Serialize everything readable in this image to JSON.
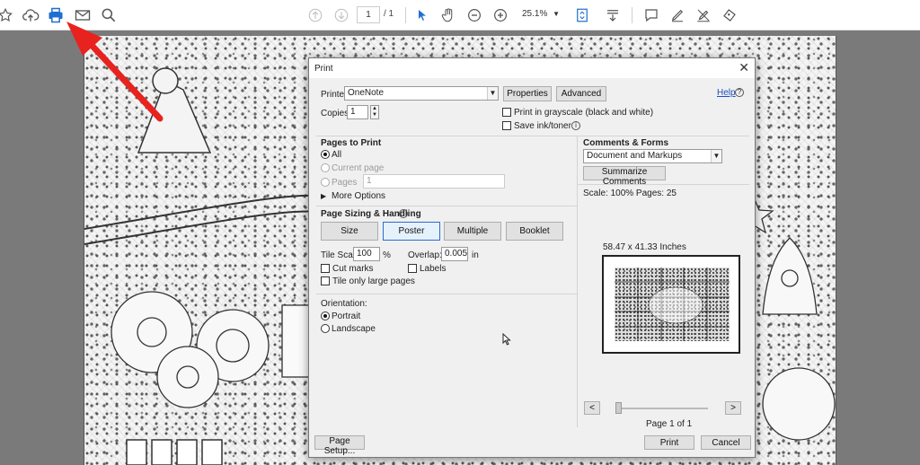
{
  "toolbar": {
    "page_current": "1",
    "page_total": "/ 1",
    "zoom": "25.1%",
    "icons": [
      "star-icon",
      "cloud-upload-icon",
      "printer-icon",
      "mail-icon",
      "zoom-search-icon",
      "page-up-icon",
      "page-down-icon",
      "select-cursor-icon",
      "hand-tool-icon",
      "zoom-out-icon",
      "zoom-in-icon",
      "fit-page-icon",
      "scroll-mode-icon",
      "comment-icon",
      "pen-icon",
      "sign-icon",
      "stamp-icon"
    ]
  },
  "dialog": {
    "title": "Print",
    "help": "Help",
    "printer_label": "Printer:",
    "printer_value": "OneNote",
    "properties_label": "Properties",
    "advanced_label": "Advanced",
    "copies_label": "Copies:",
    "copies_value": "1",
    "grayscale_label": "Print in grayscale (black and white)",
    "save_ink_label": "Save ink/toner",
    "pages_to_print": {
      "title": "Pages to Print",
      "all": "All",
      "current": "Current page",
      "pages": "Pages",
      "pages_value": "1",
      "more": "More Options"
    },
    "sizing": {
      "title": "Page Sizing & Handling",
      "size": "Size",
      "poster": "Poster",
      "multiple": "Multiple",
      "booklet": "Booklet",
      "tile_scale_label": "Tile Scale:",
      "tile_scale_value": "100",
      "percent": "%",
      "overlap_label": "Overlap:",
      "overlap_value": "0.005",
      "overlap_unit": "in",
      "cut_marks": "Cut marks",
      "labels": "Labels",
      "tile_large": "Tile only large pages"
    },
    "orientation": {
      "title": "Orientation:",
      "portrait": "Portrait",
      "landscape": "Landscape"
    },
    "comments": {
      "title": "Comments & Forms",
      "value": "Document and Markups",
      "summarize": "Summarize Comments",
      "scale": "Scale: 100% Pages: 25"
    },
    "preview": {
      "size": "58.47 x 41.33 Inches",
      "prev": "<",
      "next": ">",
      "page_of": "Page 1 of 1"
    },
    "page_setup": "Page Setup...",
    "print": "Print",
    "cancel": "Cancel"
  },
  "colors": {
    "annotation_arrow": "#e8231f",
    "toolbar_icon": "#1f6fd0",
    "link": "#1a4fc0"
  }
}
